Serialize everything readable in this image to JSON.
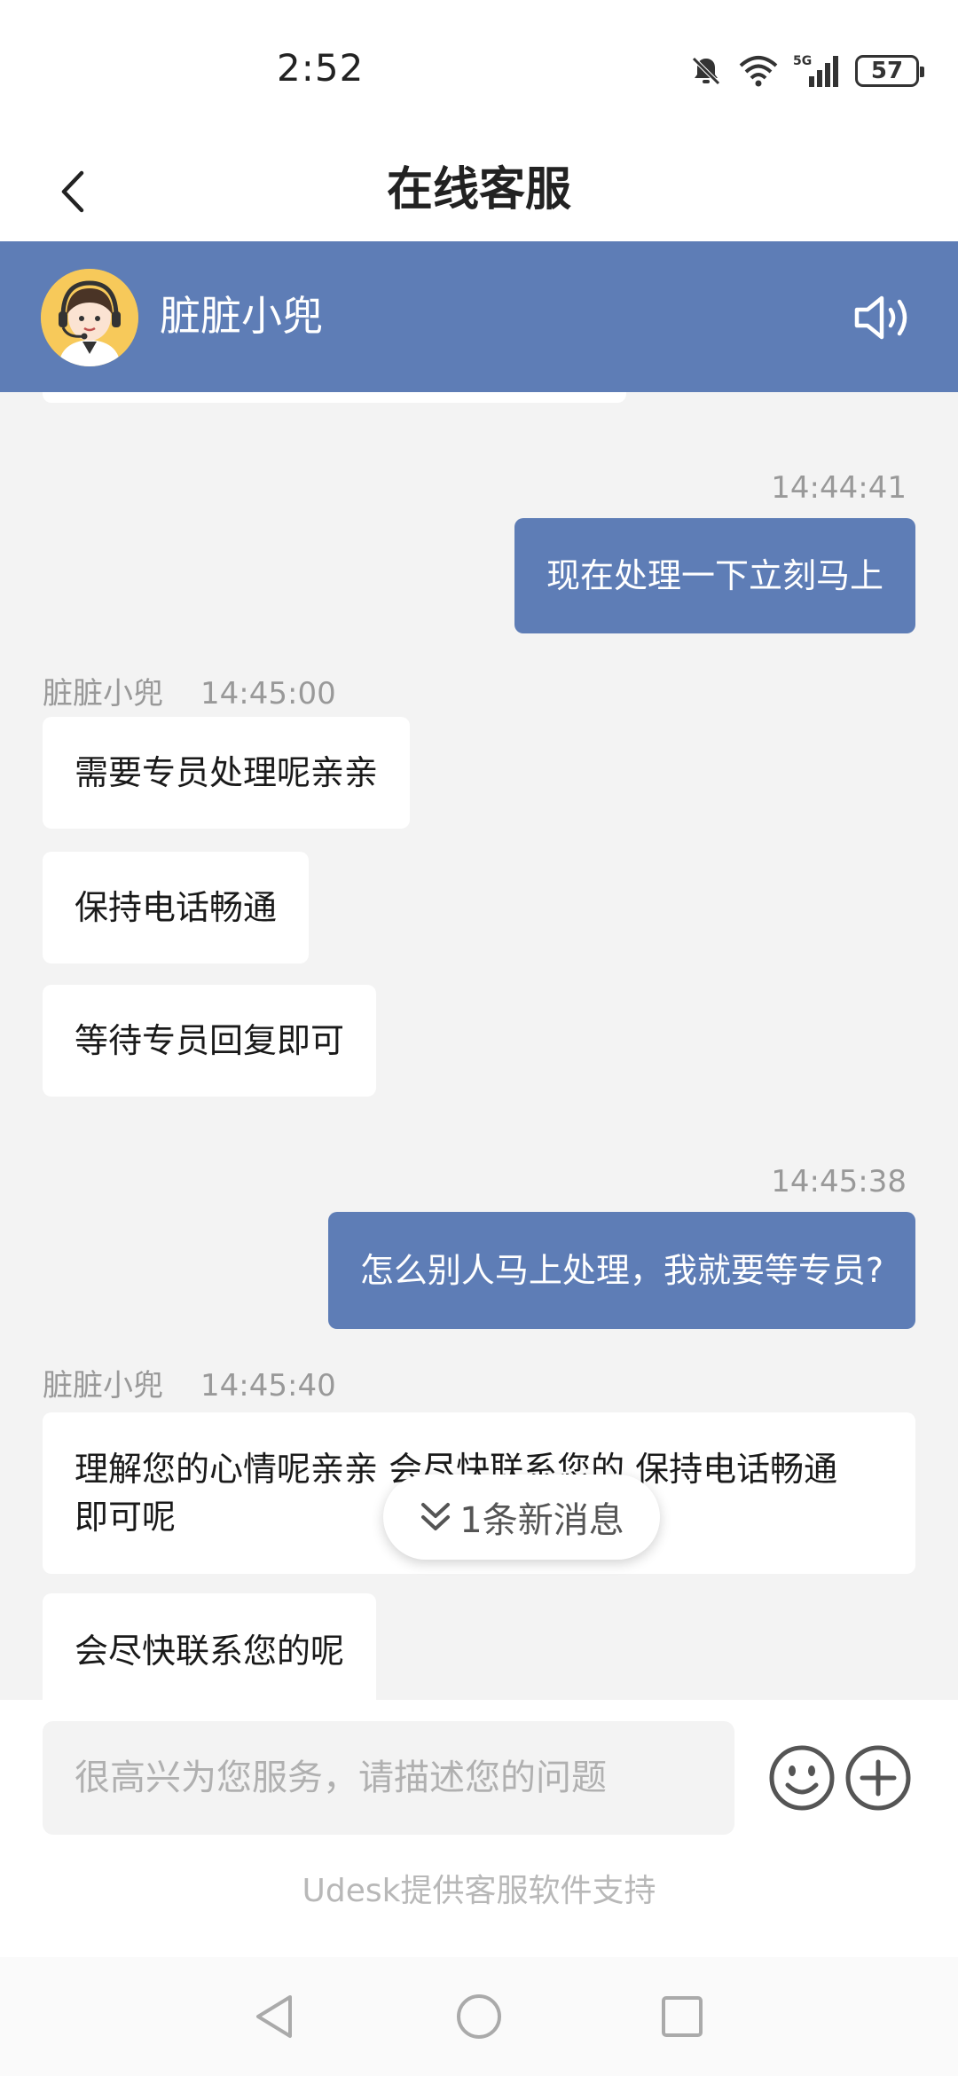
{
  "status_bar": {
    "time": "2:52",
    "battery": "57",
    "network": "5G"
  },
  "header": {
    "title": "在线客服"
  },
  "agent": {
    "name": "脏脏小兜"
  },
  "messages": [
    {
      "direction": "out",
      "time": "14:44:41",
      "text": "现在处理一下立刻马上"
    },
    {
      "direction": "in",
      "sender": "脏脏小兜",
      "time": "14:45:00",
      "texts": [
        "需要专员处理呢亲亲",
        "保持电话畅通",
        "等待专员回复即可"
      ]
    },
    {
      "direction": "out",
      "time": "14:45:38",
      "text": "怎么别人马上处理，我就要等专员?"
    },
    {
      "direction": "in",
      "sender": "脏脏小兜",
      "time": "14:45:40",
      "texts": [
        "理解您的心情呢亲亲，会尽快联系您的，保持电话畅通即可呢",
        "会尽快联系您的呢"
      ],
      "visible_text_line1": "理解您的心情呢亲亲 会尽快联系您的 保持电话畅通",
      "visible_text_line2": "即可呢"
    }
  ],
  "new_message_pill": "1条新消息",
  "input": {
    "placeholder": "很高兴为您服务，请描述您的问题",
    "value": ""
  },
  "footer": {
    "powered_by": "Udesk提供客服软件支持"
  },
  "colors": {
    "brand": "#5e7db6",
    "chat_bg": "#f3f3f3",
    "meta_text": "#999999"
  },
  "icons": {
    "back": "chevron-left-icon",
    "speaker": "speaker-icon",
    "emoji": "smiley-icon",
    "plus": "plus-circle-icon",
    "new_msg": "double-chevron-down-icon"
  }
}
